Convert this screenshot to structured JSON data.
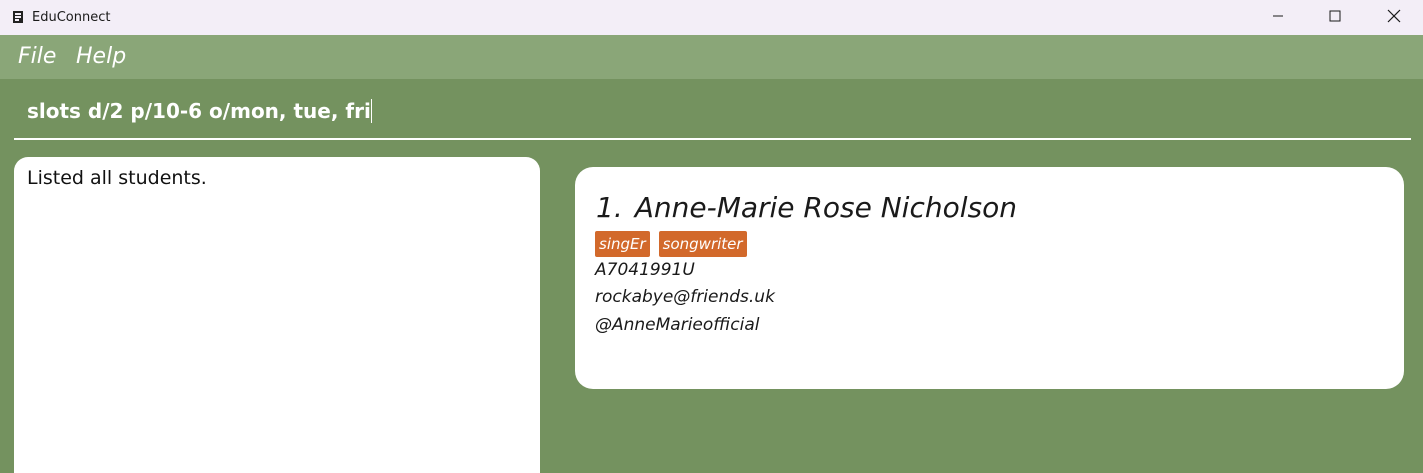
{
  "window": {
    "title": "EduConnect"
  },
  "menu": {
    "file": "File",
    "help": "Help"
  },
  "command": {
    "value": "slots d/2 p/10-6 o/mon, tue, fri"
  },
  "result": {
    "message": "Listed all students."
  },
  "students": [
    {
      "index": "1.",
      "name": "Anne-Marie Rose Nicholson",
      "tags": [
        "singEr",
        "songwriter"
      ],
      "student_id": "A7041991U",
      "email": "rockabye@friends.uk",
      "telegram": "@AnneMarieofficial"
    }
  ],
  "colors": {
    "background": "#74925f",
    "menubar": "#8aa678",
    "titlebar": "#f3eef7",
    "tag": "#d2692b"
  },
  "icons": {
    "app": "app-icon",
    "minimize": "minimize-icon",
    "maximize": "maximize-icon",
    "close": "close-icon"
  }
}
